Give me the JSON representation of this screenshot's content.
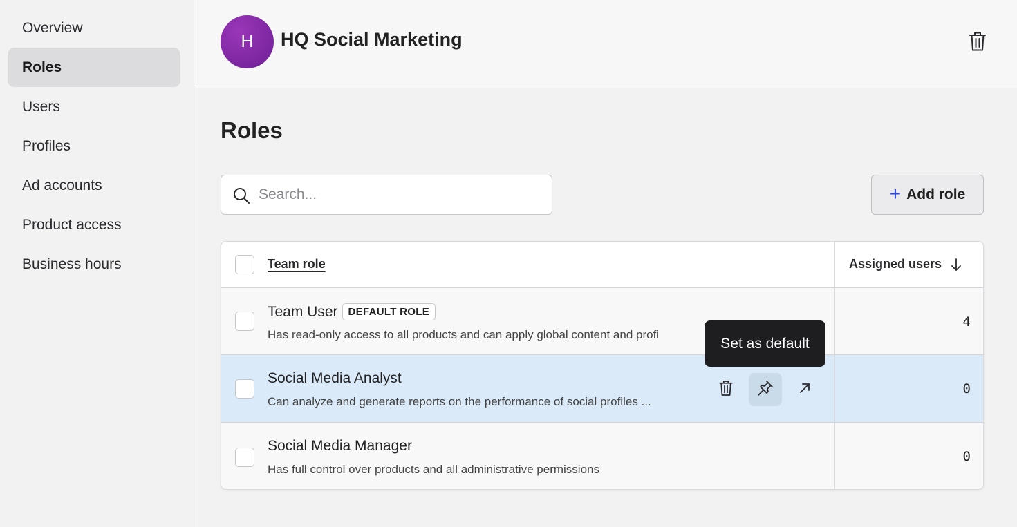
{
  "sidebar": {
    "items": [
      {
        "label": "Overview"
      },
      {
        "label": "Roles",
        "active": true
      },
      {
        "label": "Users"
      },
      {
        "label": "Profiles"
      },
      {
        "label": "Ad accounts"
      },
      {
        "label": "Product access"
      },
      {
        "label": "Business hours"
      }
    ]
  },
  "header": {
    "avatar_letter": "H",
    "org_name": "HQ Social Marketing",
    "delete_icon": "trash-icon"
  },
  "main": {
    "title": "Roles",
    "search": {
      "placeholder": "Search...",
      "value": ""
    },
    "add_role_label": "Add role",
    "table": {
      "columns": {
        "role": "Team role",
        "assigned": "Assigned users",
        "sort": "descending"
      },
      "rows": [
        {
          "name": "Team User",
          "badge": "DEFAULT ROLE",
          "description": "Has read-only access to all products and can apply global content and profi",
          "assigned": "4"
        },
        {
          "name": "Social Media Analyst",
          "badge": "",
          "description": "Can analyze and generate reports on the performance of social profiles ...",
          "assigned": "0"
        },
        {
          "name": "Social Media Manager",
          "badge": "",
          "description": "Has full control over products and all administrative permissions",
          "assigned": "0"
        }
      ]
    },
    "tooltip": "Set as default"
  },
  "colors": {
    "accent": "#2c47d6",
    "avatar": "#7b2aa3",
    "row_highlight": "#daeaf8",
    "tooltip_bg": "#1e1e21"
  }
}
